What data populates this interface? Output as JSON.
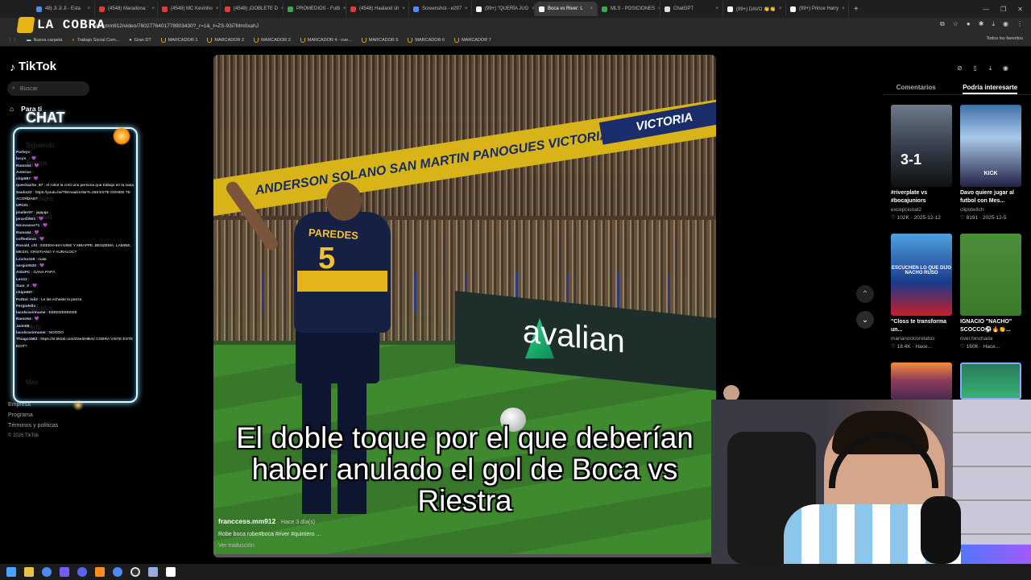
{
  "browser": {
    "tabs": [
      {
        "label": "48) Ji Ji Ji - Esta",
        "color": "#4c8bf5",
        "active": false
      },
      {
        "label": "(4548) Maradona: '",
        "color": "#e53935",
        "active": false
      },
      {
        "label": "(4548) MC Kevinho",
        "color": "#e53935",
        "active": false
      },
      {
        "label": "(4548) ¡DOBLETE D",
        "color": "#e53935",
        "active": false
      },
      {
        "label": "PROMEDIOS - Futb",
        "color": "#34a853",
        "active": false
      },
      {
        "label": "(4548) Haaland sh",
        "color": "#e53935",
        "active": false
      },
      {
        "label": "Screenshot - e297",
        "color": "#4c8bf5",
        "active": false
      },
      {
        "label": "(99+) \"QUERÍA JUG",
        "color": "#ffffff",
        "active": false
      },
      {
        "label": "Boca vs River: L",
        "color": "#ffffff",
        "active": true
      },
      {
        "label": "MLS - POSICIONES",
        "color": "#34a853",
        "active": false
      },
      {
        "label": "ChatGPT",
        "color": "#dddddd",
        "active": false
      },
      {
        "label": "(99+) DAVO 👏👏",
        "color": "#ffffff",
        "active": false
      },
      {
        "label": "(99+) Prince Harry",
        "color": "#ffffff",
        "active": false
      }
    ],
    "new_tab": "+",
    "window_controls": [
      "—",
      "❐",
      "✕"
    ],
    "url": "cess.mm912/video/7602776401778903430?_r=1&_t=ZS-93i7Mm0xahJ",
    "bookmarks": [
      "Nueva carpeta",
      "Trabajo Social Com...",
      "Gran DT",
      "MARCADOR 1",
      "MARCADOR 2",
      "MARCADOR 3",
      "MARCADOR 4 - ove...",
      "MARCADOR 5",
      "MARCADOR 6",
      "MARCADOR 7"
    ],
    "all_favorites": "Todos los favoritos"
  },
  "overlay": {
    "brand": "LA COBRA",
    "chat_title": "CHAT"
  },
  "chat": [
    {
      "user": "Parleyx",
      "msg": ""
    },
    {
      "user": "lucys_",
      "msg": "💜"
    },
    {
      "user": "Ramo64",
      "msg": "💜"
    },
    {
      "user": "Asteriss",
      "msg": ""
    },
    {
      "user": "chip687",
      "msg": "💜"
    },
    {
      "user": "quechacho_67",
      "msg": "el robot la creó una persona que trabajo en la nasa"
    },
    {
      "user": "Saulio22",
      "msg": "https://youtu.be/TkKnaab1r0&?t=268 ESTE DONDE TE ACORDAS?"
    },
    {
      "user": "UR101",
      "msg": ""
    },
    {
      "user": "jmaller07",
      "msg": "jajajaja"
    },
    {
      "user": "jerard2501",
      "msg": "💜"
    },
    {
      "user": "Nicovasse?1",
      "msg": "💜"
    },
    {
      "user": "Ramo64",
      "msg": "💜"
    },
    {
      "user": "coffeebean",
      "msg": "💜"
    },
    {
      "user": "Ronald_cht",
      "msg": "EEEEHHHH NINE Y MBAPPE, BENZEMA, LAMINE, MESSI, CRISTIANO Y AURALOC?"
    },
    {
      "user": "Lzicho318",
      "msg": "mala"
    },
    {
      "user": "sergio0520",
      "msg": "💜"
    },
    {
      "user": "AldoPC",
      "msg": "GANA PAPÁ"
    },
    {
      "user": "Leo11",
      "msg": ""
    },
    {
      "user": "Suar_Z",
      "msg": "💜"
    },
    {
      "user": "chipe687",
      "msg": ""
    },
    {
      "user": "Futbol_loli2",
      "msg": "Le las echaste la panza"
    },
    {
      "user": "Fergiolello",
      "msg": ""
    },
    {
      "user": "lacobrasinname",
      "msg": "EEEEEEEEEEE"
    },
    {
      "user": "Ramo64",
      "msg": "💜"
    },
    {
      "user": "Jaim08",
      "msg": ""
    },
    {
      "user": "lacobrasinname",
      "msg": "NOOOO"
    },
    {
      "user": "Thiago1583",
      "msg": "https://vt.tiktok.com/ZSesH8km/ COBRA VISTE ESTE EDIT?"
    }
  ],
  "tiktok": {
    "brand": "TikTok",
    "search_placeholder": "Buscar",
    "nav_home": "Para ti",
    "nav_ghost": [
      "Siguiendo",
      "Amigos",
      "Mensajes",
      "Actividad",
      "Subir",
      "Seguidos",
      "Perfil",
      "Más"
    ],
    "footer": [
      "Empresa",
      "Programa",
      "Términos y políticas"
    ],
    "copyright": "© 2026 TikTok",
    "video": {
      "caption": "El doble toque por el que deberían haber anulado el gol de Boca vs Riestra",
      "author": "franccess.mm912",
      "ago": "· Hace 3 día(s)",
      "description": "Robe boca robe#boca #river #quintero ...",
      "translate": "Ver traducción",
      "banner_text": "ANDERSON   SOLANO   SAN MARTIN   PANOGUES   VICTORIA   DIAMANTE",
      "banner2_text": "VICTORIA",
      "player_name": "PAREDES",
      "player_number": "5",
      "sponsor": "avalian"
    },
    "panel_tabs": {
      "comments": "Comentarios",
      "recommended": "Podría interesarte"
    },
    "cards": [
      {
        "title": "#riverplate vs #bocajuniors",
        "author": "excepcional2",
        "likes": "♡ 102K",
        "date": "2025-12-12",
        "overlay": "3-1"
      },
      {
        "title": "Davo quiere jugar al futbol con Mes...",
        "author": "clipstwitch",
        "likes": "♡ 8191",
        "date": "2025-12-5",
        "overlay": "KICK"
      },
      {
        "title": "\"Closs te transforma un...",
        "author": "marianoclosrelatos",
        "likes": "♡ 18.4K",
        "date": "Hace...",
        "overlay": "ESCUCHEN LO QUE DIJO NACHO RUSO"
      },
      {
        "title": "IGNACIO \"NACHO\" SCOCCO⚽🔥👏...",
        "author": "river.hinchada",
        "likes": "♡ 160K",
        "date": "Hace...",
        "overlay": ""
      }
    ]
  }
}
